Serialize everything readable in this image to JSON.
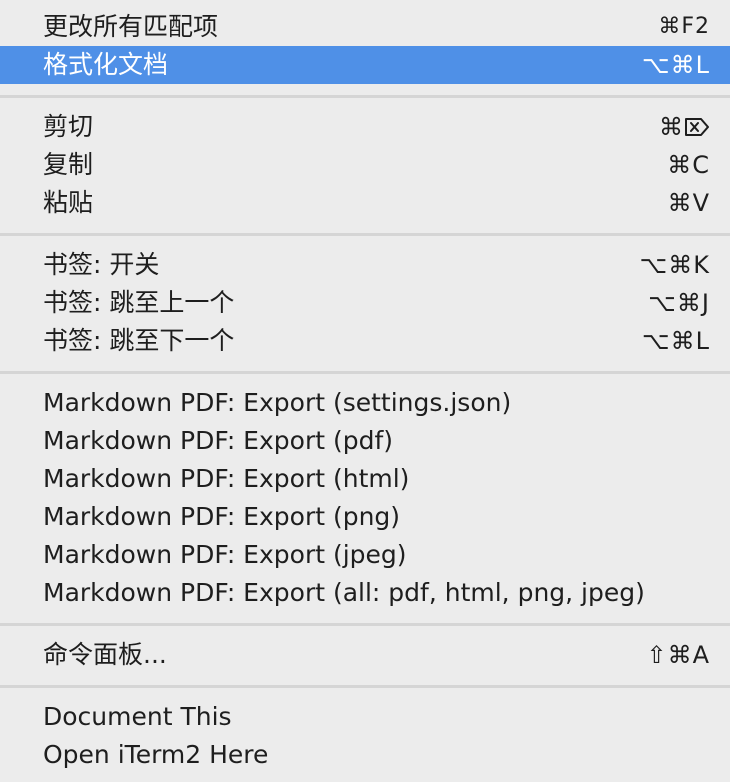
{
  "menu": {
    "groups": [
      {
        "items": [
          {
            "label": "更改所有匹配项",
            "shortcut": "⌘F2"
          },
          {
            "label": "格式化文档",
            "shortcut": "⌥⌘L",
            "highlighted": true
          }
        ]
      },
      {
        "items": [
          {
            "label": "剪切",
            "shortcut": "⌘",
            "shortcut_icon": "delete-forward-key-icon"
          },
          {
            "label": "复制",
            "shortcut": "⌘C"
          },
          {
            "label": "粘贴",
            "shortcut": "⌘V"
          }
        ]
      },
      {
        "items": [
          {
            "label": "书签: 开关",
            "shortcut": "⌥⌘K"
          },
          {
            "label": "书签: 跳至上一个",
            "shortcut": "⌥⌘J"
          },
          {
            "label": "书签: 跳至下一个",
            "shortcut": "⌥⌘L"
          }
        ]
      },
      {
        "items": [
          {
            "label": "Markdown PDF: Export (settings.json)"
          },
          {
            "label": "Markdown PDF: Export (pdf)"
          },
          {
            "label": "Markdown PDF: Export (html)"
          },
          {
            "label": "Markdown PDF: Export (png)"
          },
          {
            "label": "Markdown PDF: Export (jpeg)"
          },
          {
            "label": "Markdown PDF: Export (all: pdf, html, png, jpeg)"
          }
        ]
      },
      {
        "items": [
          {
            "label": "命令面板...",
            "shortcut": "⇧⌘A"
          }
        ]
      },
      {
        "items": [
          {
            "label": "Document This"
          },
          {
            "label": "Open iTerm2 Here"
          }
        ]
      }
    ],
    "colors": {
      "background": "#ececec",
      "highlight": "#4f90e7",
      "separator": "#d5d5d5",
      "text": "#1e1e1e"
    }
  }
}
